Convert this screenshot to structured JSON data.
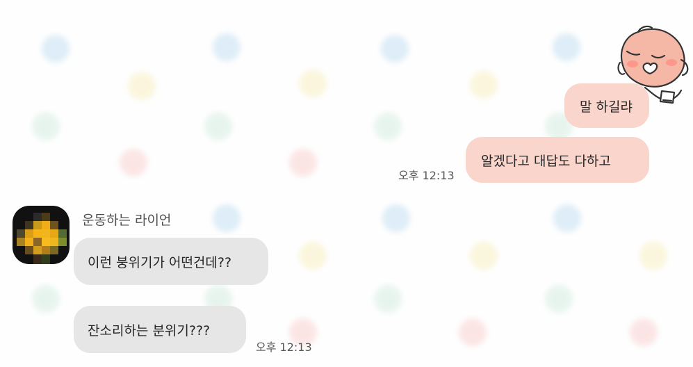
{
  "messages": {
    "outgoing": [
      {
        "text": "말 하길랴"
      },
      {
        "text": "알겠다고 대답도 다하고",
        "time": "오후 12:13"
      }
    ],
    "incoming": {
      "sender": "운동하는 라이언",
      "items": [
        {
          "text": "이런 붕위기가 어떤건데??"
        },
        {
          "text": "잔소리하는 분위기???",
          "time": "오후 12:13"
        }
      ]
    }
  },
  "icons": {
    "sticker": "apeach-sticker-icon",
    "avatar": "pixelated-profile-avatar"
  },
  "colors": {
    "background": "#fefefe",
    "outgoing_bubble": "#f9d5cb",
    "incoming_bubble": "#e6e6e6",
    "text": "#262626",
    "time_text": "#555555"
  }
}
